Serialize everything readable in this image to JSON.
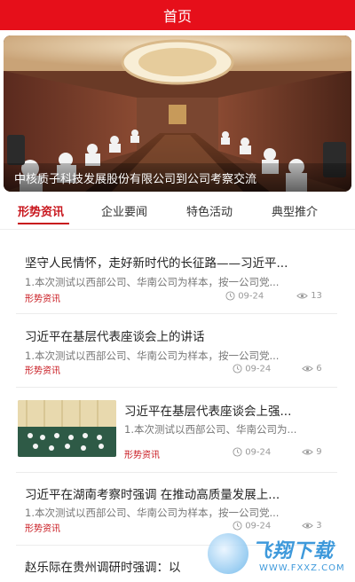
{
  "header": {
    "title": "首页"
  },
  "banner": {
    "caption": "中核质子科技发展股份有限公司到公司考察交流"
  },
  "tabs": [
    {
      "label": "形势资讯",
      "active": true
    },
    {
      "label": "企业要闻",
      "active": false
    },
    {
      "label": "特色活动",
      "active": false
    },
    {
      "label": "典型推介",
      "active": false
    }
  ],
  "news": [
    {
      "title": "坚守人民情怀，走好新时代的长征路——习近平...",
      "summary": "1.本次测试以西部公司、华南公司为样本，按一公司党...",
      "tag": "形势资讯",
      "date": "09-24",
      "views": "13",
      "has_thumb": false
    },
    {
      "title": "习近平在基层代表座谈会上的讲话",
      "summary": "1.本次测试以西部公司、华南公司为样本，按一公司党...",
      "tag": "形势资讯",
      "date": "09-24",
      "views": "6",
      "has_thumb": false
    },
    {
      "title": "习近平在基层代表座谈会上强...",
      "summary": "1.本次测试以西部公司、华南公司为...",
      "tag": "形势资讯",
      "date": "09-24",
      "views": "9",
      "has_thumb": true
    },
    {
      "title": "习近平在湖南考察时强调 在推动高质量发展上...",
      "summary": "1.本次测试以西部公司、华南公司为样本，按一公司党...",
      "tag": "形势资讯",
      "date": "09-24",
      "views": "3",
      "has_thumb": false
    },
    {
      "title": "赵乐际在贵州调研时强调：以",
      "summary": "",
      "tag": "",
      "date": "",
      "views": "",
      "has_thumb": false
    }
  ],
  "watermark": {
    "brand": "飞翔下载",
    "url": "WWW.FXXZ.COM"
  },
  "colors": {
    "primary_red": "#e60f1a",
    "tag_red": "#c8161d"
  },
  "icons": {
    "date": "clock-icon",
    "views": "eye-icon"
  }
}
